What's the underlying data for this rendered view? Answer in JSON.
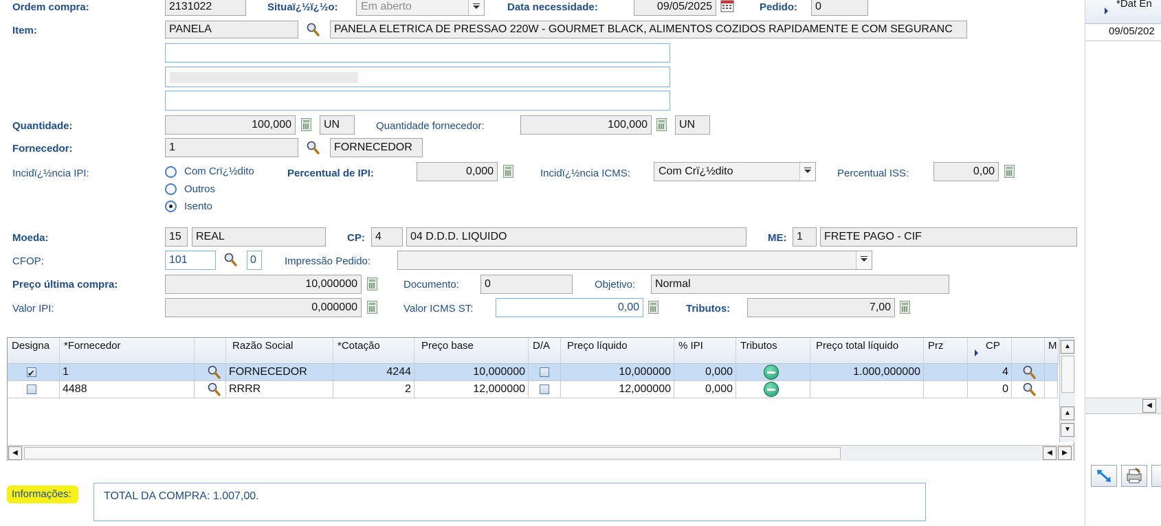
{
  "form": {
    "ordem_compra_label": "Ordem compra:",
    "ordem_compra_value": "2131022",
    "situacao_label": "Situaï¿½ï¿½o:",
    "situacao_value": "Em aberto",
    "data_necessidade_label": "Data necessidade:",
    "data_necessidade_value": "09/05/2025",
    "pedido_label": "Pedido:",
    "pedido_value": "0",
    "item_label": "Item:",
    "item_code": "PANELA",
    "item_desc": "PANELA ELETRICA DE PRESSAO 220W - GOURMET BLACK, ALIMENTOS COZIDOS RAPIDAMENTE E COM SEGURANC",
    "quantidade_label": "Quantidade:",
    "quantidade_value": "100,000",
    "quantidade_un": "UN",
    "quantidade_forn_label": "Quantidade fornecedor:",
    "quantidade_forn_value": "100,000",
    "quantidade_forn_un": "UN",
    "fornecedor_label": "Fornecedor:",
    "fornecedor_code": "1",
    "fornecedor_name": "FORNECEDOR",
    "incidencia_ipi_label": "Incidï¿½ncia IPI:",
    "ipi_options": [
      "Com Crï¿½dito",
      "Outros",
      "Isento"
    ],
    "ipi_selected": "Isento",
    "percentual_ipi_label": "Percentual de IPI:",
    "percentual_ipi_value": "0,000",
    "incidencia_icms_label": "Incidï¿½ncia ICMS:",
    "incidencia_icms_value": "Com Crï¿½dito",
    "percentual_iss_label": "Percentual ISS:",
    "percentual_iss_value": "0,00",
    "moeda_label": "Moeda:",
    "moeda_code": "15",
    "moeda_name": "REAL",
    "cp_label": "CP:",
    "cp_code": "4",
    "cp_name": "04 D.D.D. LIQUIDO",
    "me_label": "ME:",
    "me_code": "1",
    "me_name": "FRETE PAGO - CIF",
    "cfop_label": "CFOP:",
    "cfop_code": "101",
    "cfop_sub": "0",
    "impressao_label": "Impressão Pedido:",
    "impressao_value": "",
    "preco_ultima_label": "Preço  última compra:",
    "preco_ultima_value": "10,000000",
    "documento_label": "Documento:",
    "documento_value": "0",
    "objetivo_label": "Objetivo:",
    "objetivo_value": "Normal",
    "valor_ipi_label": "Valor IPI:",
    "valor_ipi_value": "0,000000",
    "valor_icms_st_label": "Valor ICMS ST:",
    "valor_icms_st_value": "0,00",
    "tributos_label": "Tributos:",
    "tributos_value": "7,00"
  },
  "grid": {
    "headers": [
      "Designa",
      "*Fornecedor",
      "",
      "Razão Social",
      "*Cotação",
      "Preço base",
      "D/A",
      "Preço líquido",
      "% IPI",
      "Tributos",
      "Preço total líquido",
      "Prz",
      "CP",
      "",
      "M"
    ],
    "rows": [
      {
        "designa": true,
        "fornecedor": "1",
        "razao": "FORNECEDOR",
        "cotacao": "4244",
        "preco_base": "10,000000",
        "da": false,
        "preco_liquido": "10,000000",
        "ipi": "0,000",
        "total": "1.000,000000",
        "prz": "",
        "cp": "4"
      },
      {
        "designa": false,
        "fornecedor": "4488",
        "razao": "RRRR",
        "cotacao": "2",
        "preco_base": "12,000000",
        "da": false,
        "preco_liquido": "12,000000",
        "ipi": "0,000",
        "total": "",
        "prz": "",
        "cp": "0"
      }
    ]
  },
  "info": {
    "label": "Informações:",
    "text": "TOTAL DA COMPRA: 1.007,00."
  },
  "side_panel": {
    "header": "*Dat En",
    "value": "09/05/202"
  },
  "colors": {
    "label_blue": "#1f4e8c",
    "selected_row": "#c7dcf5",
    "highlight_yellow": "#f7f01a"
  }
}
